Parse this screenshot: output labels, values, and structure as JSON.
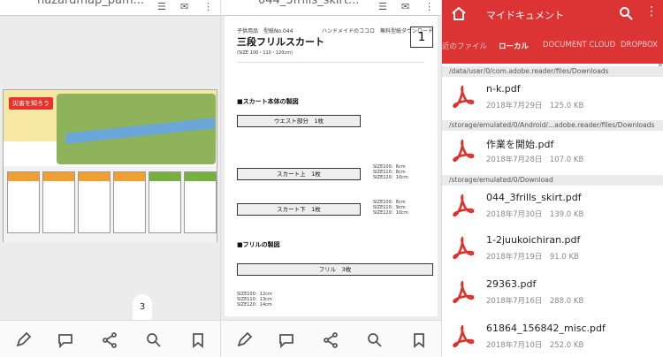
{
  "panel1": {
    "doc_title": "hazardmap_pam...",
    "map_title": "災害を知ろう",
    "page_indicator": "3"
  },
  "panel2": {
    "doc_title": "044_3frills_skirt...",
    "header_left": "子供用品　型紙No.044",
    "header_right": "ハンドメイドのココロ　無料型紙ダウンロード",
    "title": "三段フリルスカート",
    "size": "(SIZE 100・110・120cm)",
    "page": "1",
    "section1": "■スカート本体の製図",
    "section2": "■フリルの製図",
    "bars": [
      {
        "label": "ウエスト部分　1枚"
      },
      {
        "label": "スカート上　1枚"
      },
      {
        "label": "スカート下　1枚"
      },
      {
        "label": "フリル　3枚"
      }
    ],
    "notes": [
      "SIZE100：6cm\nSIZE110：8cm\nSIZE120：10cm",
      "SIZE100：8cm\nSIZE110：9cm\nSIZE120：10cm",
      "SIZE100：12cm\nSIZE110：13cm\nSIZE120：14cm"
    ]
  },
  "panel3": {
    "title": "マイドキュメント",
    "tabs": [
      "近のファイル",
      "ローカル",
      "DOCUMENT CLOUD",
      "DROPBOX"
    ],
    "active_tab": 1,
    "groups": [
      {
        "path": "/data/user/0/com.adobe.reader/files/Downloads",
        "files": [
          {
            "name": "n-k.pdf",
            "meta": "2018年7月29日　125.0 KB"
          }
        ]
      },
      {
        "path": "/storage/emulated/0/Android/...adobe.reader/files/Downloads",
        "files": [
          {
            "name": "作業を開始.pdf",
            "meta": "2018年7月28日　107.0 KB"
          }
        ]
      },
      {
        "path": "/storage/emulated/0/Download",
        "files": [
          {
            "name": "044_3frills_skirt.pdf",
            "meta": "2018年7月30日　139.0 KB"
          },
          {
            "name": "1-2juukoichiran.pdf",
            "meta": "2018年7月19日　91.0 KB"
          },
          {
            "name": "29363.pdf",
            "meta": "2018年7月16日　288.0 KB"
          },
          {
            "name": "61864_156842_misc.pdf",
            "meta": "2018年7月10日　252.0 KB"
          }
        ]
      }
    ]
  },
  "icons": {
    "pdf_red": "#e0302a",
    "accent": "#dc3434"
  }
}
